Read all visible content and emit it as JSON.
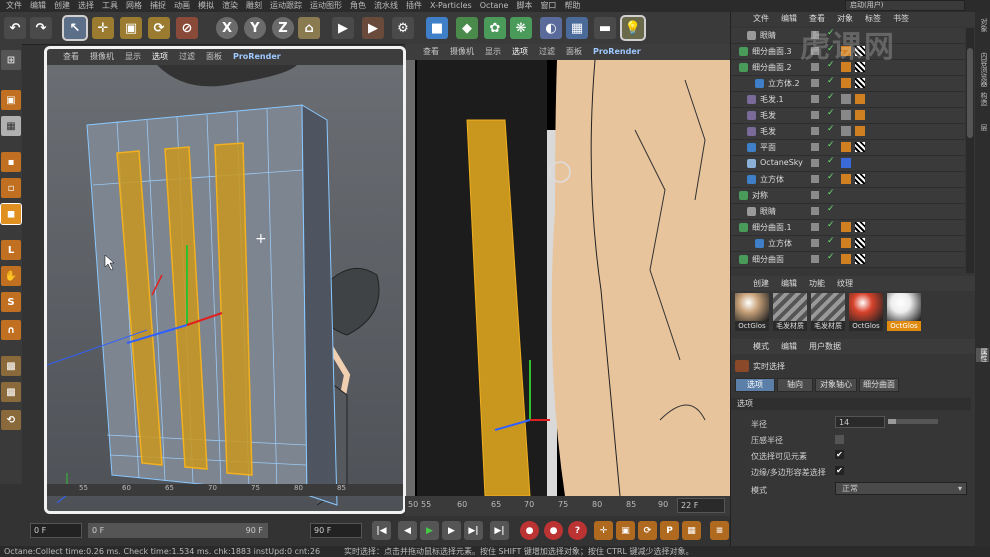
{
  "menu": [
    "文件",
    "编辑",
    "创建",
    "选择",
    "工具",
    "网格",
    "捕捉",
    "动画",
    "模拟",
    "渲染",
    "雕刻",
    "运动跟踪",
    "运动图形",
    "角色",
    "流水线",
    "插件",
    "X-Particles",
    "Octane",
    "脚本",
    "窗口",
    "帮助"
  ],
  "layout_label": "启动(用户)",
  "axes_buttons": [
    "X",
    "Y",
    "Z"
  ],
  "viewport_menu": [
    "查看",
    "摄像机",
    "显示",
    "选项",
    "过滤",
    "面板"
  ],
  "viewport_renderer": "ProRender",
  "timeline": {
    "ruler_ticks": [
      "50",
      "55",
      "60",
      "65",
      "70",
      "75",
      "80",
      "85",
      "90"
    ],
    "left_ticks": [
      "55",
      "60",
      "65",
      "70",
      "75",
      "80",
      "85"
    ],
    "current_frame": "22 F",
    "start_frame": "0 F",
    "range_start": "0 F",
    "range_end": "90 F",
    "end_frame": "90 F"
  },
  "status": {
    "left": "Octane:Collect time:0.26 ms.  Check time:1.534 ms.  chk:1883  instUpd:0  cnt:26",
    "right": "实时选择：点击并拖动鼠标选择元素。按住 SHIFT 键增加选择对象；按住 CTRL 键减少选择对象。"
  },
  "object_manager": {
    "menu": [
      "文件",
      "编辑",
      "查看",
      "对象",
      "标签",
      "书签"
    ],
    "objects": [
      {
        "name": "眼睛",
        "indent": 1,
        "icon": "null"
      },
      {
        "name": "细分曲面.3",
        "indent": 0,
        "icon": "subd"
      },
      {
        "name": "细分曲面.2",
        "indent": 0,
        "icon": "subd"
      },
      {
        "name": "立方体.2",
        "indent": 2,
        "icon": "cube"
      },
      {
        "name": "毛发.1",
        "indent": 1,
        "icon": "hair"
      },
      {
        "name": "毛发",
        "indent": 1,
        "icon": "hair"
      },
      {
        "name": "毛发",
        "indent": 1,
        "icon": "hair"
      },
      {
        "name": "平面",
        "indent": 1,
        "icon": "plane"
      },
      {
        "name": "OctaneSky",
        "indent": 1,
        "icon": "sky"
      },
      {
        "name": "立方体",
        "indent": 1,
        "icon": "cube"
      },
      {
        "name": "对称",
        "indent": 0,
        "icon": "sym"
      },
      {
        "name": "眼睛",
        "indent": 1,
        "icon": "null"
      },
      {
        "name": "细分曲面.1",
        "indent": 0,
        "icon": "subd"
      },
      {
        "name": "立方体",
        "indent": 2,
        "icon": "cube"
      },
      {
        "name": "细分曲面",
        "indent": 0,
        "icon": "subd"
      }
    ]
  },
  "material_manager": {
    "menu": [
      "创建",
      "编辑",
      "功能",
      "纹理"
    ],
    "materials": [
      {
        "label": "OctGlos",
        "color": "#c8a27a",
        "selected": false
      },
      {
        "label": "毛发材质",
        "color": "#777777",
        "selected": false
      },
      {
        "label": "毛发材质",
        "color": "#777777",
        "selected": false
      },
      {
        "label": "OctGlos",
        "color": "#d8432c",
        "selected": false
      },
      {
        "label": "OctGlos",
        "color": "#eeeeee",
        "selected": true
      }
    ]
  },
  "attributes": {
    "menu": [
      "模式",
      "编辑",
      "用户数据"
    ],
    "tool_name": "实时选择",
    "tabs": [
      "选项",
      "轴向",
      "对象轴心",
      "细分曲面"
    ],
    "section": "选项",
    "radius_label": "半径",
    "radius_value": "14",
    "pressure_label": "压感半径",
    "visible_only_label": "仅选择可见元素",
    "tolerant_label": "边缘/多边形容差选择",
    "mode_label": "模式",
    "mode_value": "正常"
  },
  "right_tabs": [
    "对象",
    "内容浏览器",
    "构造",
    "层",
    "属性"
  ],
  "watermark": "虎课网",
  "colors": {
    "accent": "#f0a020",
    "selection": "#e7a21a",
    "ui_bg": "#3a3a3a",
    "skin": "#e8c49d"
  }
}
